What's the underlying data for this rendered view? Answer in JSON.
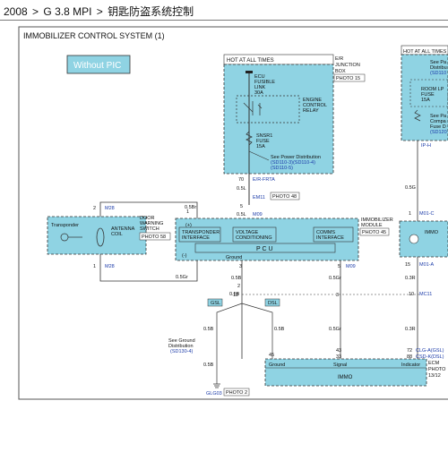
{
  "breadcrumb": {
    "items": [
      "2008",
      "G 3.8 MPI",
      "钥匙防盗系统控制"
    ],
    "separator": ">"
  },
  "diagram": {
    "title": "IMMOBILIZER CONTROL SYSTEM (1)",
    "without_pic": "Without PIC",
    "hot": "HOT AT ALL TIMES",
    "hot_right": "HOT AT ALL TIMES",
    "er_junction": [
      "E/R",
      "JUNCTION",
      "BOX"
    ],
    "photo15": "PHOTO 15",
    "ecu_link": [
      "ECU",
      "FUSIBLE",
      "LINK",
      "30A"
    ],
    "relay": [
      "ENGINE",
      "CONTROL",
      "RELAY"
    ],
    "snsr_fuse": [
      "SNSR1",
      "FUSE",
      "15A"
    ],
    "see_power": "See Power Distribution",
    "sd_ref1": "(SD110-3)(SD110-4)",
    "sd_ref2": "(SD110-5)",
    "pin70": "70",
    "er_frta": "E/R-FRTA",
    "w05l_a": "0.5L",
    "em11": "EM11",
    "photo48": "PHOTO 48",
    "pin5": "5",
    "w05l_b": "0.5L",
    "m09_top": "M09",
    "transponder": "Transponder",
    "antenna_coil": [
      "ANTENNA",
      "COIL"
    ],
    "door_switch": [
      "DOOR",
      "WARNING",
      "SWITCH"
    ],
    "photo58": "PHOTO 58",
    "m28_top": "M28",
    "m28_bot": "M28",
    "pin2": "2",
    "pin1": "1",
    "w05br": "0.5Br",
    "w05gr_a": "0.5Gr",
    "p_plus": "(+)",
    "p_minus": "(-)",
    "transponder_if": [
      "TRANSPONDER",
      "INTERFACE"
    ],
    "voltage_cond": [
      "VOLTAGE",
      "CONDITIONING"
    ],
    "comms_if": [
      "COMMS",
      "INTERFACE"
    ],
    "pcu": "P C U",
    "ground": "Ground",
    "imm_module": [
      "IMMOBILIZER",
      "MODULE"
    ],
    "photo45": "PHOTO 45",
    "pin1b": "1",
    "pin3": "3",
    "pin5b": "5",
    "w05b_a": "0.5B",
    "w05gr_b": "0.5Gr",
    "m09_bot": "M09",
    "pin2b": "2",
    "w05b_b": "0.5B",
    "pin12": "12",
    "pin3b": "3",
    "gsl": "GSL",
    "dsl": "DSL",
    "see_ground": [
      "See Ground",
      "Distribution"
    ],
    "sd130": "(SD130-4)",
    "w05b_c": "0.5B",
    "w05b_d": "0.5B",
    "w05b_e": "0.5B",
    "w05gr_c": "0.5Gr",
    "g03": "GLG03",
    "photo2": "PHOTO 2",
    "pin45": "45",
    "pin43": "43",
    "pin33": "33",
    "ecm_ground": "Ground",
    "ecm_signal": "Signal",
    "ecm_indicator": "Indicator",
    "immo_lower": "IMMO",
    "right_see": [
      "See Pa",
      "Distribu",
      "(SD110"
    ],
    "room_lp": [
      "ROOM LP",
      "FUSE",
      "15A"
    ],
    "right_see2": [
      "See Pa",
      "Compa",
      "Fuse D",
      "(SD120"
    ],
    "ip_h": "IP-H",
    "w05g": "0.5G",
    "pin1c": "1",
    "m01c": "M01-C",
    "immo_right": "IMMO",
    "pin15": "15",
    "m01a": "M01-A",
    "w03r_a": "0.3R",
    "pin10": "10",
    "mc11": "MC11",
    "w03r_b": "0.3R",
    "pin72": "72",
    "pin88": "88",
    "clg": "CLG-A(GSL)",
    "csd": "CSD-K(DSL)",
    "ecm": "ECM",
    "photo_r": [
      "PHOTO",
      "13/12"
    ]
  },
  "colors": {
    "module_fill": "#8fd3e3",
    "wire": "#3a3a3a",
    "ref_text": "#1a3aa8",
    "frame": "#555555"
  }
}
